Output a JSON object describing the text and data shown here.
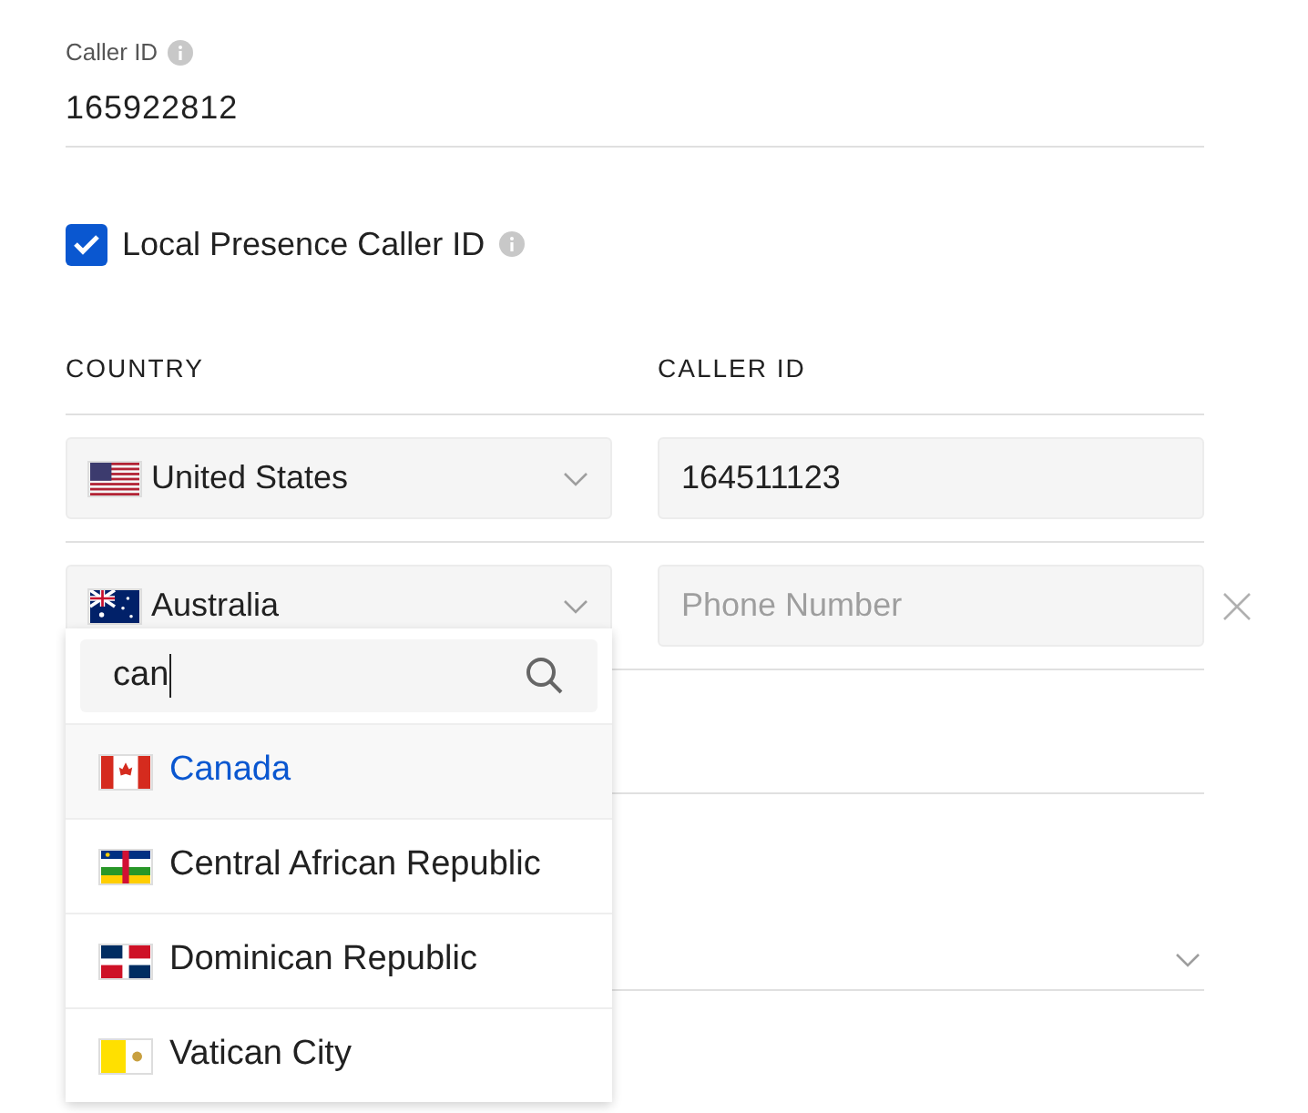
{
  "caller_id": {
    "label": "Caller ID",
    "value": "165922812"
  },
  "local_presence": {
    "label": "Local Presence Caller ID",
    "checked": true
  },
  "table": {
    "columns": [
      "COUNTRY",
      "CALLER ID"
    ],
    "rows": [
      {
        "country": "United States",
        "kind": "us",
        "caller_id": "164511123",
        "removable": false
      },
      {
        "country": "Australia",
        "kind": "au",
        "placeholder": "Phone Number",
        "removable": true
      }
    ]
  },
  "dropdown": {
    "search": "can",
    "options": [
      {
        "label": "Canada",
        "kind": "ca",
        "selected": true
      },
      {
        "label": "Central African Republic",
        "kind": "cf",
        "selected": false
      },
      {
        "label": "Dominican Republic",
        "kind": "do",
        "selected": false
      },
      {
        "label": "Vatican City",
        "kind": "va",
        "selected": false
      }
    ]
  }
}
